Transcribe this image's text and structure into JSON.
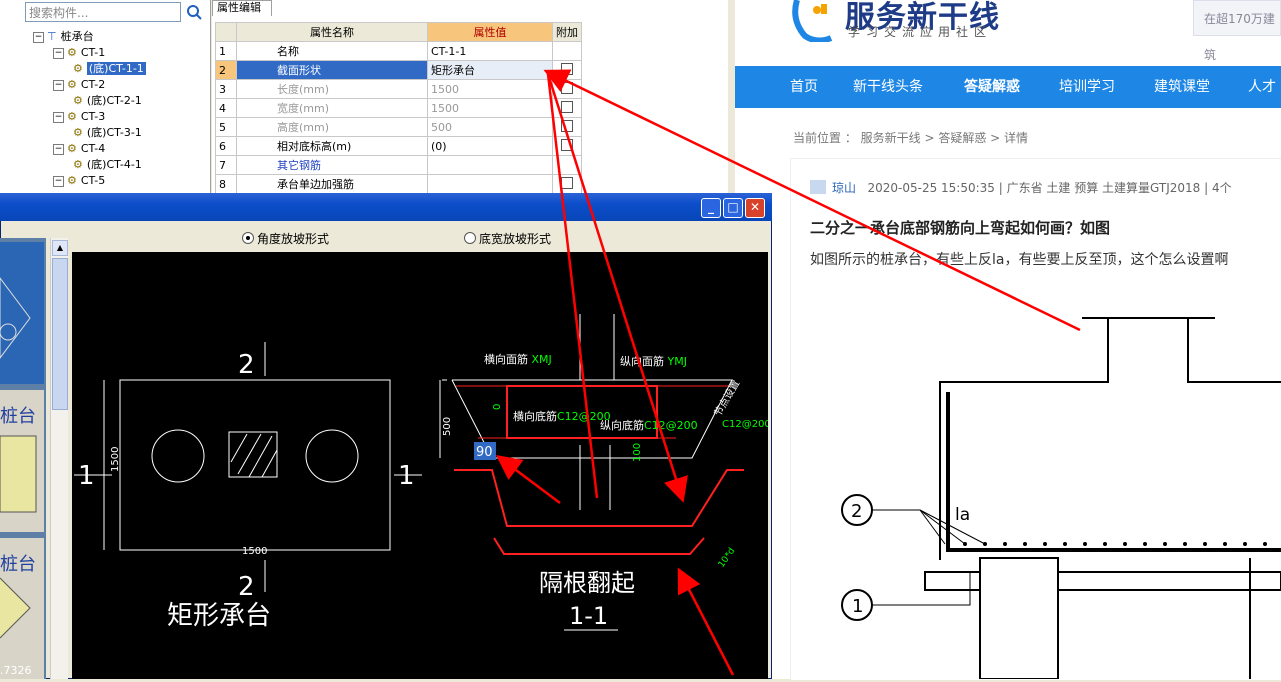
{
  "tree": {
    "search_placeholder": "搜索构件...",
    "root": "桩承台",
    "items": [
      {
        "label": "CT-1",
        "level": 1,
        "expander": "−"
      },
      {
        "label": "(底)CT-1-1",
        "level": 2,
        "selected": true
      },
      {
        "label": "CT-2",
        "level": 1,
        "expander": "−"
      },
      {
        "label": "(底)CT-2-1",
        "level": 2
      },
      {
        "label": "CT-3",
        "level": 1,
        "expander": "−"
      },
      {
        "label": "(底)CT-3-1",
        "level": 2
      },
      {
        "label": "CT-4",
        "level": 1,
        "expander": "−"
      },
      {
        "label": "(底)CT-4-1",
        "level": 2
      },
      {
        "label": "CT-5",
        "level": 1,
        "expander": "−"
      }
    ]
  },
  "props": {
    "tab": "属性编辑",
    "header": {
      "name": "属性名称",
      "value": "属性值",
      "extra": "附加"
    },
    "rows": [
      {
        "num": "1",
        "name": "名称",
        "value": "CT-1-1",
        "style": "normal",
        "check": false
      },
      {
        "num": "2",
        "name": "截面形状",
        "value": "矩形承台",
        "style": "selected",
        "check": true
      },
      {
        "num": "3",
        "name": "长度(mm)",
        "value": "1500",
        "style": "gray",
        "check": true
      },
      {
        "num": "4",
        "name": "宽度(mm)",
        "value": "1500",
        "style": "gray",
        "check": true
      },
      {
        "num": "5",
        "name": "高度(mm)",
        "value": "500",
        "style": "gray",
        "check": true
      },
      {
        "num": "6",
        "name": "相对底标高(m)",
        "value": "(0)",
        "style": "normal",
        "check": true
      },
      {
        "num": "7",
        "name": "其它钢筋",
        "value": "",
        "style": "blue",
        "check": false
      },
      {
        "num": "8",
        "name": "承台单边加强筋",
        "value": "",
        "style": "normal",
        "check": true
      }
    ]
  },
  "dialog": {
    "radio_angle": "角度放坡形式",
    "radio_width": "底宽放坡形式",
    "coord": "7326",
    "cad": {
      "plan_title": "矩形承台",
      "section_top": "2",
      "section_bottom": "2",
      "side_left": "1",
      "side_right": "1",
      "dim_width": "1500",
      "dim_height": "1500",
      "label_top_trans": "横向面筋",
      "code_top_trans": "XMJ",
      "label_top_long": "纵向面筋",
      "code_top_long": "YMJ",
      "label_bot_trans": "横向底筋",
      "code_bot_trans": "C12@200",
      "label_bot_long": "纵向底筋",
      "code_bot_long": "C12@200",
      "code_side": "C12@200",
      "side_note": "节点设置",
      "dim_500": "500",
      "angle": "90",
      "note_bend": "隔根翻起",
      "section_11": "1-1",
      "small_0": "0",
      "small_100": "100",
      "small_10d": "10*d"
    }
  },
  "web": {
    "logo": "服务新干线",
    "logo_sub": "学习交流应用社区",
    "search_hint": "在超170万建筑",
    "nav": [
      "首页",
      "新干线头条",
      "答疑解惑",
      "培训学习",
      "建筑课堂",
      "人才"
    ],
    "nav_active": "答疑解惑",
    "breadcrumb": "当前位置 ： 服务新干线 > 答疑解惑 > 详情",
    "meta_user": "琼山",
    "meta_rest": "2020-05-25 15:50:35  |  广东省  土建 预算 土建算量GTJ2018  |  4个",
    "title": "二分之一承台底部钢筋向上弯起如何画？如图",
    "body": "如图所示的桩承台，有些上反la，有些要上反至顶，这个怎么设置啊",
    "fig_label_1": "1",
    "fig_label_2": "2",
    "fig_la": "la"
  },
  "colors": {
    "annotation_arrow": "#ff0000",
    "nav_bg": "#1e87e5",
    "cad_bg": "#000000",
    "rebar": "#ff2020"
  }
}
